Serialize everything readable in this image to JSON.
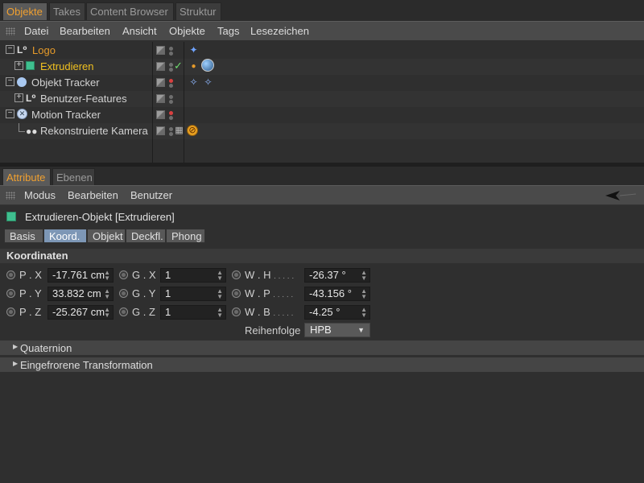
{
  "top_tabs": [
    "Objekte",
    "Takes",
    "Content Browser",
    "Struktur"
  ],
  "top_menu": [
    "Datei",
    "Bearbeiten",
    "Ansicht",
    "Objekte",
    "Tags",
    "Lesezeichen"
  ],
  "objects": [
    {
      "label": "Logo",
      "color": "#e59a2a"
    },
    {
      "label": "Extrudieren",
      "color": "#f0c020"
    },
    {
      "label": "Objekt Tracker",
      "color": "#d2d2d2"
    },
    {
      "label": "Benutzer-Features",
      "color": "#d2d2d2"
    },
    {
      "label": "Motion Tracker",
      "color": "#d2d2d2"
    },
    {
      "label": "Rekonstruierte Kamera",
      "color": "#d2d2d2"
    }
  ],
  "attr_tabs": [
    "Attribute",
    "Ebenen"
  ],
  "attr_menu": [
    "Modus",
    "Bearbeiten",
    "Benutzer"
  ],
  "object_title": "Extrudieren-Objekt [Extrudieren]",
  "sub_tabs": [
    "Basis",
    "Koord.",
    "Objekt",
    "Deckfl.",
    "Phong"
  ],
  "section_title": "Koordinaten",
  "pos": [
    {
      "label": "P . X",
      "value": "-17.761 cm"
    },
    {
      "label": "P . Y",
      "value": "33.832 cm"
    },
    {
      "label": "P . Z",
      "value": "-25.267 cm"
    }
  ],
  "scale": [
    {
      "label": "G . X",
      "value": "1"
    },
    {
      "label": "G . Y",
      "value": "1"
    },
    {
      "label": "G . Z",
      "value": "1"
    }
  ],
  "rot": [
    {
      "label": "W . H",
      "dots": ". . . . .",
      "value": "-26.37 °"
    },
    {
      "label": "W . P",
      "dots": ". . . . .",
      "value": "-43.156 °"
    },
    {
      "label": "W . B",
      "dots": ". . . . .",
      "value": "-4.25 °"
    }
  ],
  "order_label": "Reihenfolge",
  "order_value": "HPB",
  "collapsed_sections": [
    "Quaternion",
    "Eingefrorene Transformation"
  ],
  "colors": {
    "accent": "#f0a030",
    "active_subtab": "#7d97b6"
  }
}
